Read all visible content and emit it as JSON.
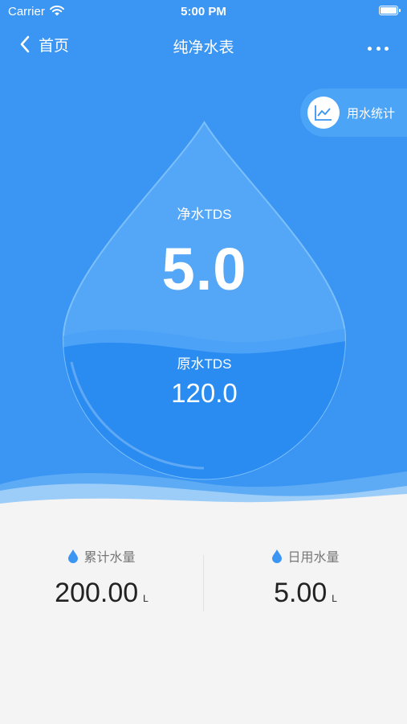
{
  "status_bar": {
    "carrier": "Carrier",
    "time": "5:00 PM"
  },
  "nav": {
    "back_label": "首页",
    "title": "纯净水表"
  },
  "stats_button": {
    "label": "用水统计"
  },
  "tds": {
    "pure_label": "净水TDS",
    "pure_value": "5.0",
    "raw_label": "原水TDS",
    "raw_value": "120.0"
  },
  "summary": {
    "total": {
      "label": "累计水量",
      "value": "200.00",
      "unit": "L"
    },
    "daily": {
      "label": "日用水量",
      "value": "5.00",
      "unit": "L"
    }
  },
  "colors": {
    "primary": "#3a95f3",
    "accent": "#4ba4f6",
    "background": "#f4f4f4"
  },
  "icons": {
    "back": "chevron-left-icon",
    "more": "more-dots-icon",
    "stats": "trend-chart-icon",
    "water": "water-drop-icon"
  }
}
